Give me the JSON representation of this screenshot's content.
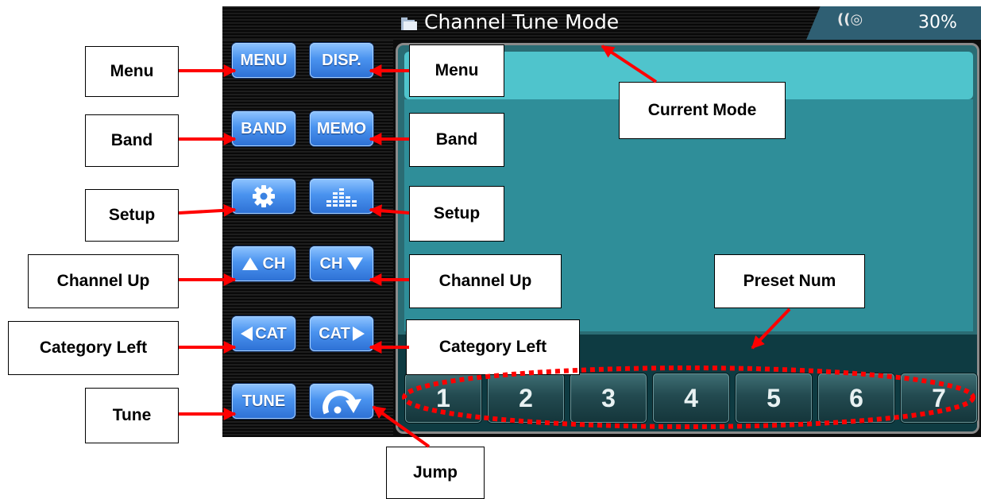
{
  "screen": {
    "title": "Channel Tune Mode",
    "signal_icon": "((◎",
    "battery": "30%",
    "colors": {
      "button_blue": "#4a93ef",
      "panel_teal": "#2f8e99",
      "header_cyan": "#4fc4cc",
      "preset_bar": "#0e3b42",
      "arrow_red": "#ff0000"
    },
    "buttons": {
      "menu": "MENU",
      "disp": "DISP.",
      "band": "BAND",
      "memo": "MEMO",
      "setup_icon": "gear-icon",
      "eq_icon": "equalizer-icon",
      "ch": "CH",
      "cat": "CAT",
      "tune": "TUNE",
      "jump_icon": "jump-arrow-icon"
    },
    "presets": [
      "1",
      "2",
      "3",
      "4",
      "5",
      "6",
      "7"
    ]
  },
  "annotations": {
    "menu_left": "Menu",
    "menu_right": "Menu",
    "band_left": "Band",
    "band_right": "Band",
    "setup_left": "Setup",
    "setup_right": "Setup",
    "ch_left": "Channel Up",
    "ch_right": "Channel Up",
    "cat_left": "Category Left",
    "cat_right": "Category Left",
    "tune": "Tune",
    "jump": "Jump",
    "current_mode": "Current Mode",
    "preset_num": "Preset Num"
  }
}
